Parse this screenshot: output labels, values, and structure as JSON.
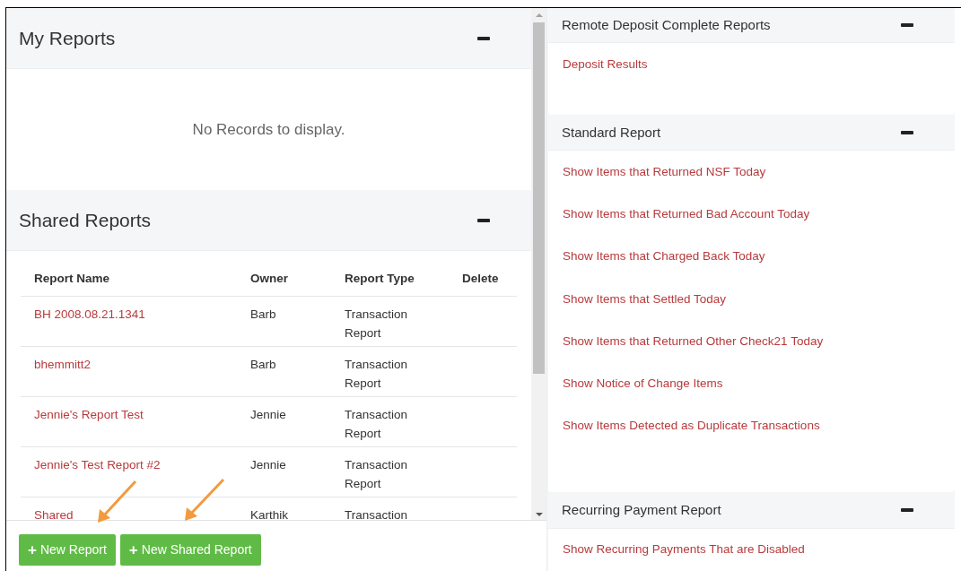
{
  "my_reports": {
    "title": "My Reports",
    "empty_message": "No Records to display."
  },
  "shared_reports": {
    "title": "Shared Reports",
    "columns": [
      "Report Name",
      "Owner",
      "Report Type",
      "Delete"
    ],
    "rows": [
      {
        "name": "BH 2008.08.21.1341",
        "owner": "Barb",
        "type": "Transaction Report"
      },
      {
        "name": "bhemmitt2",
        "owner": "Barb",
        "type": "Transaction Report"
      },
      {
        "name": "Jennie's Report Test",
        "owner": "Jennie",
        "type": "Transaction Report"
      },
      {
        "name": "Jennie's Test Report #2",
        "owner": "Jennie",
        "type": "Transaction Report"
      },
      {
        "name": "Shared",
        "owner": "Karthik",
        "type": "Transaction"
      }
    ]
  },
  "buttons": [
    {
      "icon": "+",
      "label": "New Report"
    },
    {
      "icon": "+",
      "label": "New Shared Report"
    }
  ],
  "right_sections": [
    {
      "title": "Remote Deposit Complete Reports",
      "links": [
        "Deposit Results"
      ]
    },
    {
      "title": "Standard Report",
      "links": [
        "Show Items that Returned NSF Today",
        "Show Items that Returned Bad Account Today",
        "Show Items that Charged Back Today",
        "Show Items that Settled Today",
        "Show Items that Returned Other Check21 Today",
        "Show Notice of Change Items",
        "Show Items Detected as Duplicate Transactions"
      ]
    },
    {
      "title": "Recurring Payment Report",
      "links": [
        "Show Recurring Payments That are Disabled"
      ]
    }
  ]
}
